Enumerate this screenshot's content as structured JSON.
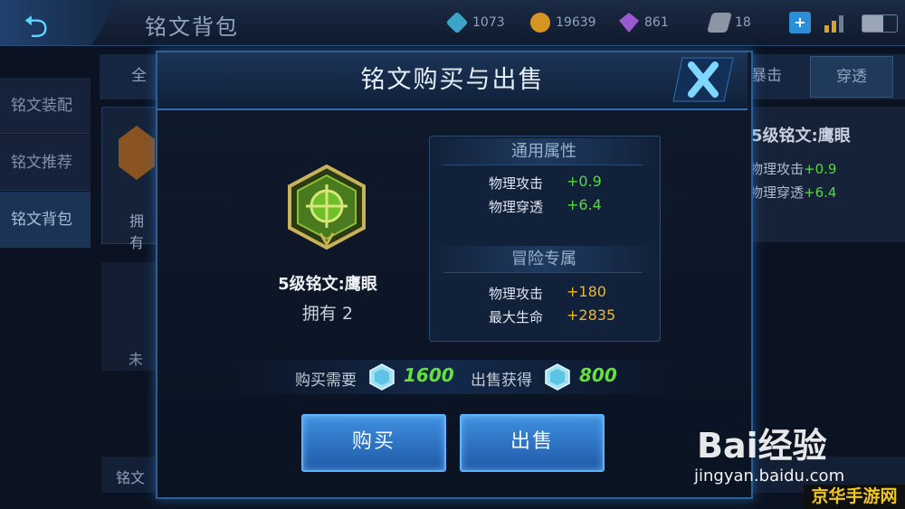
{
  "topbar": {
    "title": "铭文背包",
    "resources": [
      {
        "icon": "crystal-icon",
        "value": "1073",
        "color": "#3aa5c6"
      },
      {
        "icon": "gold-coin-icon",
        "value": "19639",
        "color": "#d59520"
      },
      {
        "icon": "diamond-icon",
        "value": "861",
        "color": "#9a5ad0"
      },
      {
        "icon": "ticket-icon",
        "value": "18",
        "color": "#8b95a6"
      }
    ]
  },
  "sidebar": {
    "items": [
      {
        "label": "铭文装配"
      },
      {
        "label": "铭文推荐"
      },
      {
        "label": "铭文背包"
      }
    ]
  },
  "background": {
    "tab_all_partial": "全",
    "tab_crit_partial": "暴击",
    "tab_penetration": "穿透",
    "card_own_partial": "拥有",
    "card_unowned_partial": "未",
    "right_title": "5级铭文:鹰眼",
    "right_stat1": "物理攻击",
    "right_stat1_val": "+0.9",
    "right_stat2": "物理穿透",
    "right_stat2_val": "+6.4",
    "bottom_partial": "铭文"
  },
  "modal": {
    "title": "铭文购买与出售",
    "rune_name": "5级铭文:鹰眼",
    "owned": "拥有 2",
    "general": {
      "heading": "通用属性",
      "stats": [
        {
          "name": "物理攻击",
          "value": "+0.9"
        },
        {
          "name": "物理穿透",
          "value": "+6.4"
        }
      ]
    },
    "adventure": {
      "heading": "冒险专属",
      "stats": [
        {
          "name": "物理攻击",
          "value": "+180"
        },
        {
          "name": "最大生命",
          "value": "+2835"
        }
      ]
    },
    "buy_label": "购买需要",
    "buy_price": "1600",
    "sell_label": "出售获得",
    "sell_price": "800",
    "buy_button": "购买",
    "sell_button": "出售"
  },
  "watermark": {
    "baidu": "Bai经验",
    "url": "jingyan.baidu.com",
    "site": "京华手游网"
  }
}
